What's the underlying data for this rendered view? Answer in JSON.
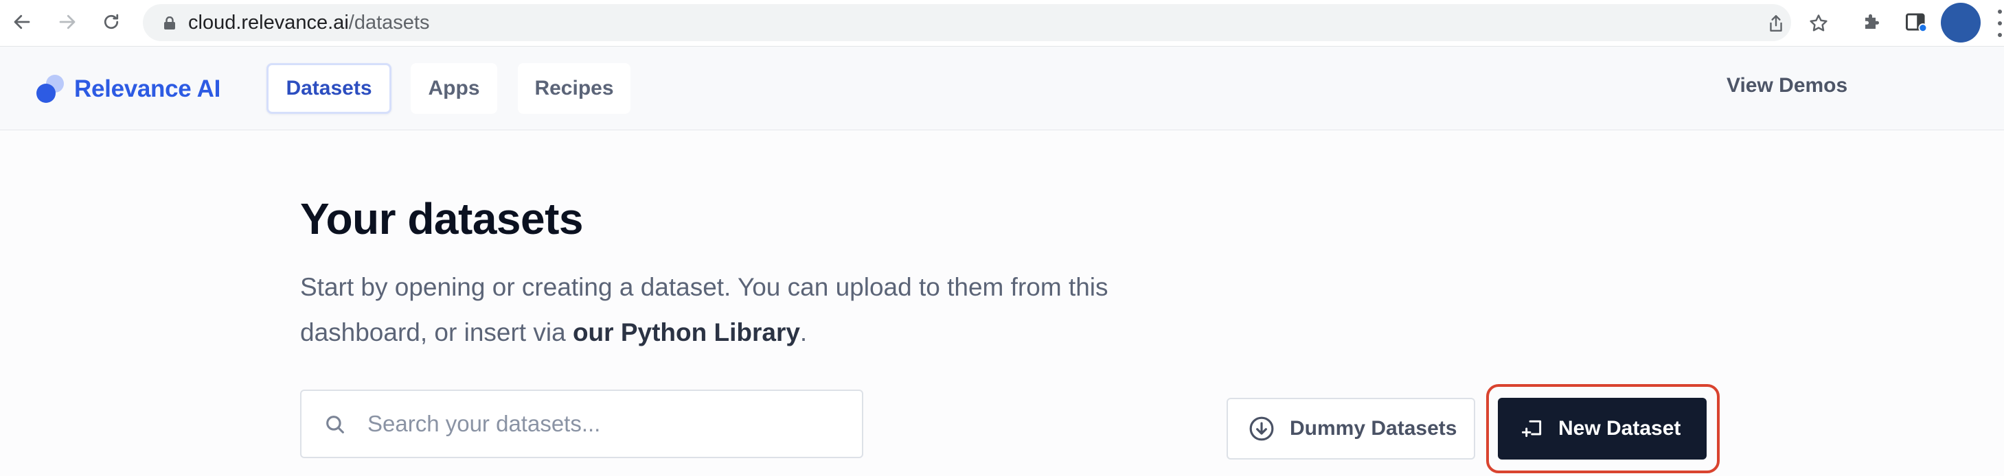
{
  "browser": {
    "url_host": "cloud.relevance.ai",
    "url_path": "/datasets"
  },
  "app": {
    "brand": "Relevance AI",
    "tabs": [
      {
        "label": "Datasets",
        "active": true
      },
      {
        "label": "Apps",
        "active": false
      },
      {
        "label": "Recipes",
        "active": false
      }
    ],
    "view_demos": "View Demos"
  },
  "main": {
    "title": "Your datasets",
    "description_prefix": "Start by opening or creating a dataset. You can upload to them from this dashboard, or insert via ",
    "description_link": "our Python Library",
    "description_suffix": ".",
    "search_placeholder": "Search your datasets...",
    "dummy_button": "Dummy Datasets",
    "new_button": "New Dataset"
  },
  "colors": {
    "brand": "#2d5be3",
    "primary_button": "#121b2e",
    "highlight": "#d9432f"
  }
}
